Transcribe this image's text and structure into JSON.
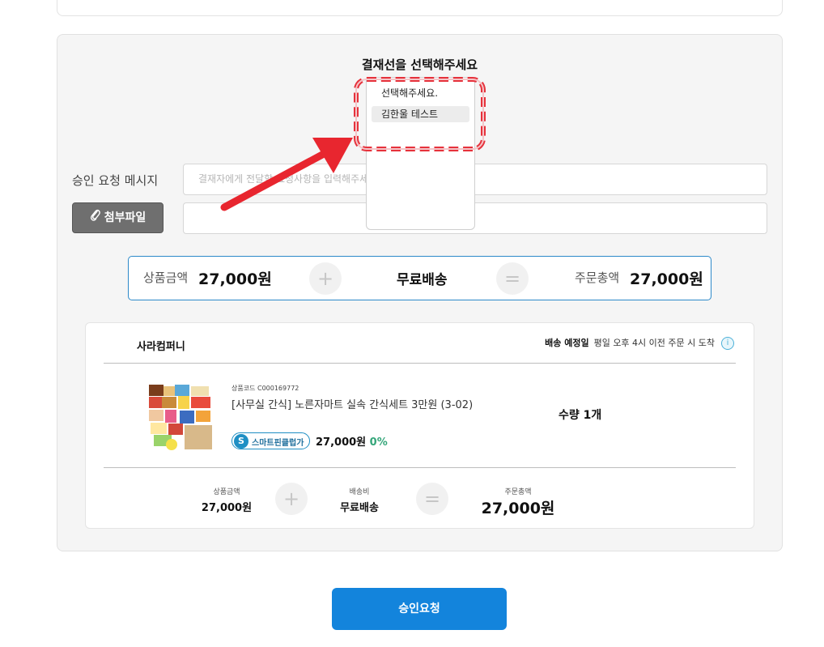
{
  "approver": {
    "title": "결재선을 선택해주세요",
    "options": [
      "선택해주세요.",
      "김한울 테스트"
    ]
  },
  "message": {
    "label": "승인 요청 메시지",
    "placeholder": "결재자에게 전달할 요청사항을 입력해주세요"
  },
  "attachment": {
    "button_label": "첨부파일",
    "icon": "paperclip-icon"
  },
  "summary": {
    "product_label": "상품금액",
    "product_value": "27,000원",
    "plus": "+",
    "shipping_value": "무료배송",
    "equals": "=",
    "total_label": "주문총액",
    "total_value": "27,000원"
  },
  "order": {
    "vendor": "사라컴퍼니",
    "delivery_label": "배송 예정일",
    "delivery_text": "평일 오후 4시 이전 주문 시 도착",
    "info_icon": "i",
    "product_code": "상품코드 C000169772",
    "product_name": "[사무실 간식] 노른자마트 실속 간식세트 3만원 (3-02)",
    "badge_icon": "S",
    "badge_label": "스마트핀클럽가",
    "badge_price": "27,000원",
    "badge_discount": "0%",
    "quantity": "수량 1개",
    "footer": {
      "product_label": "상품금액",
      "product_value": "27,000원",
      "shipping_label": "배송비",
      "shipping_value": "무료배송",
      "total_label": "주문총액",
      "total_value": "27,000원",
      "plus": "+",
      "equals": "="
    }
  },
  "submit_label": "승인요청",
  "colors": {
    "accent": "#1384dc",
    "highlight": "#e6323c",
    "discount": "#35a67a"
  }
}
